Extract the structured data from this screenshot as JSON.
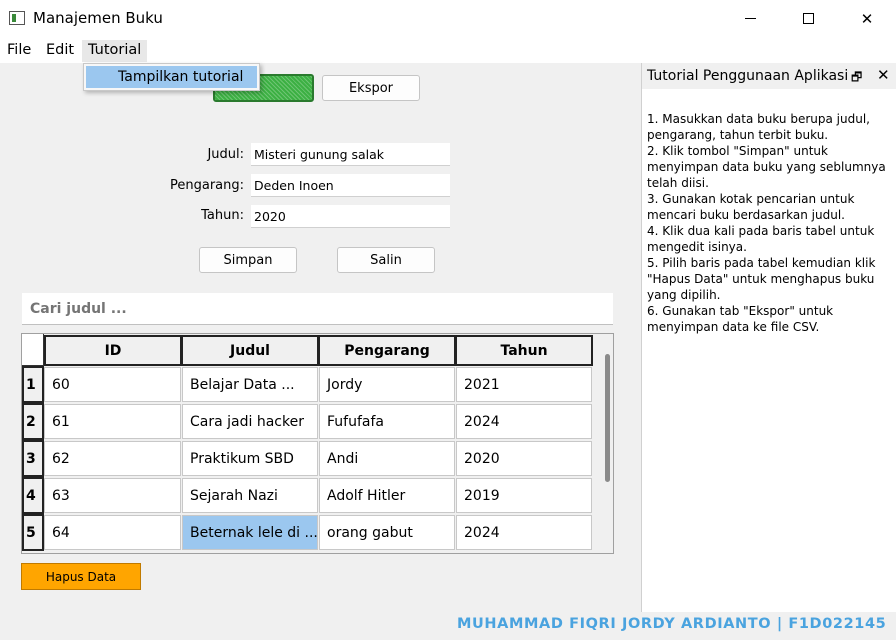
{
  "window": {
    "title": "Manajemen Buku"
  },
  "menubar": {
    "file": "File",
    "edit": "Edit",
    "tutorial": "Tutorial"
  },
  "dropdown": {
    "item": "Tampilkan tutorial"
  },
  "toolbar": {
    "export_label": "Ekspor"
  },
  "form": {
    "judul_label": "Judul:",
    "judul_value": "Misteri gunung salak",
    "pengarang_label": "Pengarang:",
    "pengarang_value": "Deden Inoen",
    "tahun_label": "Tahun:",
    "tahun_value": "2020",
    "simpan_label": "Simpan",
    "salin_label": "Salin"
  },
  "search": {
    "placeholder": "Cari judul ..."
  },
  "table": {
    "columns": [
      "ID",
      "Judul",
      "Pengarang",
      "Tahun"
    ],
    "rows": [
      {
        "num": "1",
        "id": "60",
        "judul": "Belajar Data ...",
        "pengarang": "Jordy",
        "tahun": "2021"
      },
      {
        "num": "2",
        "id": "61",
        "judul": "Cara jadi hacker",
        "pengarang": "Fufufafa",
        "tahun": "2024"
      },
      {
        "num": "3",
        "id": "62",
        "judul": "Praktikum SBD",
        "pengarang": "Andi",
        "tahun": "2020"
      },
      {
        "num": "4",
        "id": "63",
        "judul": "Sejarah Nazi",
        "pengarang": "Adolf Hitler",
        "tahun": "2019"
      },
      {
        "num": "5",
        "id": "64",
        "judul": "Beternak lele di ...",
        "pengarang": "orang gabut",
        "tahun": "2024"
      }
    ]
  },
  "hapus_label": "Hapus Data",
  "dock": {
    "title": "Tutorial Penggunaan Aplikasi",
    "steps": [
      "1. Masukkan data buku berupa judul, pengarang, tahun terbit buku.",
      "2. Klik tombol \"Simpan\" untuk menyimpan data buku yang seblumnya telah diisi.",
      "3. Gunakan kotak pencarian untuk mencari buku berdasarkan judul.",
      "4. Klik dua kali pada baris tabel untuk mengedit isinya.",
      "5. Pilih baris pada tabel kemudian klik \"Hapus Data\" untuk menghapus buku yang dipilih.",
      "6. Gunakan tab \"Ekspor\" untuk menyimpan data ke file CSV."
    ]
  },
  "footer": "MUHAMMAD FIQRI JORDY ARDIANTO | F1D022145",
  "colors": {
    "accent_green": "#3cb043",
    "selected": "#9bc7ef",
    "hapus_orange": "#ffa500",
    "footer_blue": "#4aa3df"
  }
}
